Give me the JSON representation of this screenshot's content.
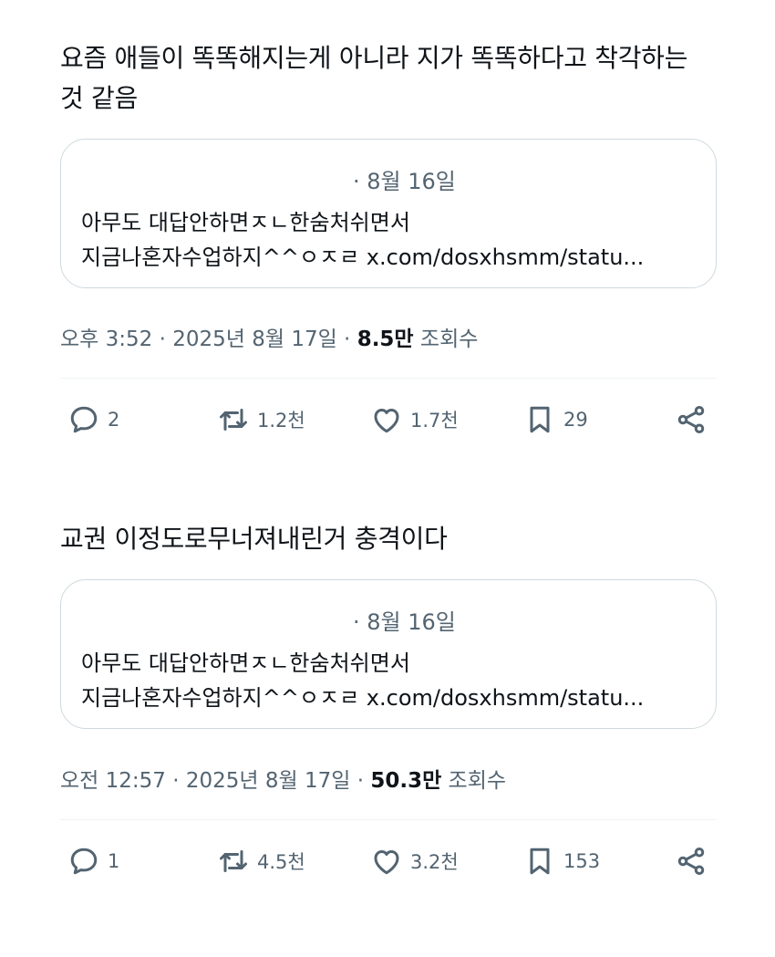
{
  "posts": [
    {
      "text": "요즘 애들이 똑똑해지는게 아니라 지가 똑똑하다고 착각하는 것 같음",
      "quote": {
        "date": "· 8월 16일",
        "line1": "아무도 대답안하면ㅈㄴ한숨처쉬면서",
        "line2": "지금나혼자수업하지^^ㅇㅈㄹ x.com/dosxhsmm/statu..."
      },
      "meta": {
        "time_date": "오후 3:52 · 2025년 8월 17일 · ",
        "views": "8.5만",
        "views_label": " 조회수"
      },
      "actions": {
        "replies": "2",
        "reposts": "1.2천",
        "likes": "1.7천",
        "bookmarks": "29"
      }
    },
    {
      "text": "교권 이정도로무너져내린거 충격이다",
      "quote": {
        "date": "· 8월 16일",
        "line1": "아무도 대답안하면ㅈㄴ한숨처쉬면서",
        "line2": "지금나혼자수업하지^^ㅇㅈㄹ x.com/dosxhsmm/statu..."
      },
      "meta": {
        "time_date": "오전 12:57 · 2025년 8월 17일 · ",
        "views": "50.3만",
        "views_label": " 조회수"
      },
      "actions": {
        "replies": "1",
        "reposts": "4.5천",
        "likes": "3.2천",
        "bookmarks": "153"
      }
    }
  ],
  "icons": {
    "reply": "reply-icon",
    "repost": "repost-icon",
    "like": "heart-icon",
    "bookmark": "bookmark-icon",
    "share": "share-icon"
  },
  "colors": {
    "text": "#0f1419",
    "secondary": "#536471",
    "border": "#cfd9de"
  }
}
